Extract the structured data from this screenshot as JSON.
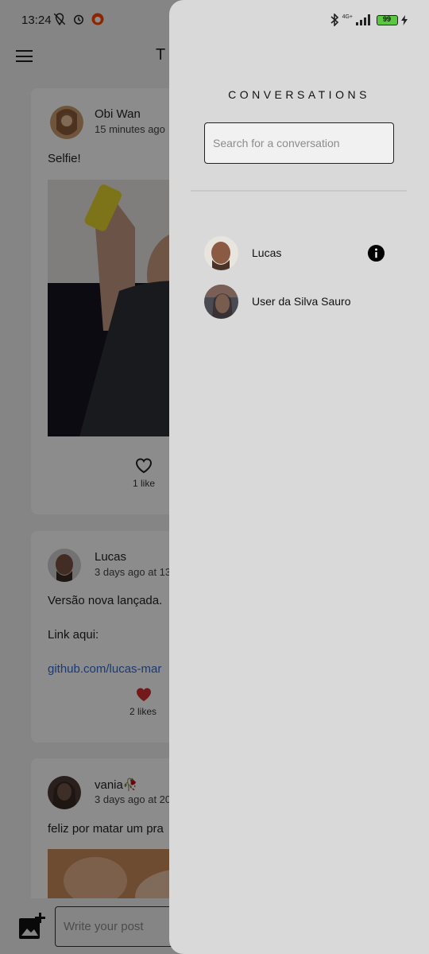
{
  "status_bar": {
    "time": "13:24",
    "battery": "99",
    "network": "4G+"
  },
  "app": {
    "title": "T"
  },
  "posts": [
    {
      "author": "Obi Wan",
      "time": "15 minutes ago",
      "text": "Selfie!",
      "likes": "1 like",
      "liked": false
    },
    {
      "author": "Lucas",
      "time": "3 days ago at 13",
      "text_line1": "Versão nova lançada.",
      "text_line2": "Link aqui:",
      "link": "github.com/lucas-mar",
      "likes": "2 likes",
      "liked": true
    },
    {
      "author": "vania🥀",
      "time": "3 days ago at 20",
      "text": "feliz por matar um pra"
    }
  ],
  "composer": {
    "placeholder": "Write your post"
  },
  "drawer": {
    "title": "CONVERSATIONS",
    "search_placeholder": "Search for a conversation",
    "conversations": [
      {
        "name": "Lucas",
        "has_info": true
      },
      {
        "name": "User da Silva Sauro",
        "has_info": false
      }
    ]
  },
  "colors": {
    "drawer_bg": "#d9d9d9",
    "like_red": "#d32f2f",
    "link_blue": "#2f6bd6",
    "battery_green": "#5ac83c"
  }
}
